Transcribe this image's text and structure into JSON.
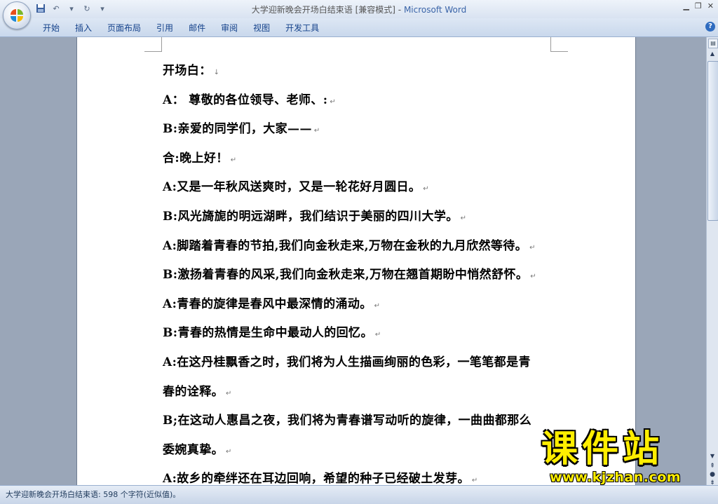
{
  "window": {
    "doc_name": "大学迎新晚会开场白结束语 [兼容模式]",
    "separator": " - ",
    "app_name": "Microsoft Word"
  },
  "ribbon": {
    "tabs": [
      "开始",
      "插入",
      "页面布局",
      "引用",
      "邮件",
      "审阅",
      "视图",
      "开发工具"
    ]
  },
  "document": {
    "paragraphs": [
      "开场白：",
      "A： 尊敬的各位领导、老师、:",
      "B:亲爱的同学们，大家——",
      "合:晚上好！",
      "A:又是一年秋风送爽时，又是一轮花好月圆日。",
      "B:风光旖旎的明远湖畔，我们结识于美丽的四川大学。",
      "A:脚踏着青春的节拍,我们向金秋走来,万物在金秋的九月欣然等待。",
      "B:激扬着青春的风采,我们向金秋走来,万物在翘首期盼中悄然舒怀。",
      "A:青春的旋律是春风中最深情的涌动。",
      "B:青春的热情是生命中最动人的回忆。",
      "A:在这丹桂飘香之时，我们将为人生描画绚丽的色彩，一笔笔都是青",
      "春的诠释。",
      "B;在这动人惠昌之夜，我们将为青春谱写动听的旋律，一曲曲都那么",
      "委婉真挚。",
      "A:故乡的牵绊还在耳边回响，希望的种子已经破土发芽。"
    ],
    "marks": [
      "↓",
      "↵",
      "↵",
      "↵",
      "↵",
      "↵",
      "↵",
      "↵",
      "↵",
      "↵",
      "",
      "↵",
      "",
      "↵",
      "↵"
    ]
  },
  "status": {
    "text": "大学迎新晚会开场白结束语: 598 个字符(近似值)。"
  },
  "watermark": {
    "title": "课件站",
    "url": "www.kjzhan.com"
  },
  "colors": {
    "office_logo": [
      "#e94e1b",
      "#7bb72b",
      "#1f8ad6",
      "#f5b900"
    ],
    "watermark": "#ffee00"
  }
}
